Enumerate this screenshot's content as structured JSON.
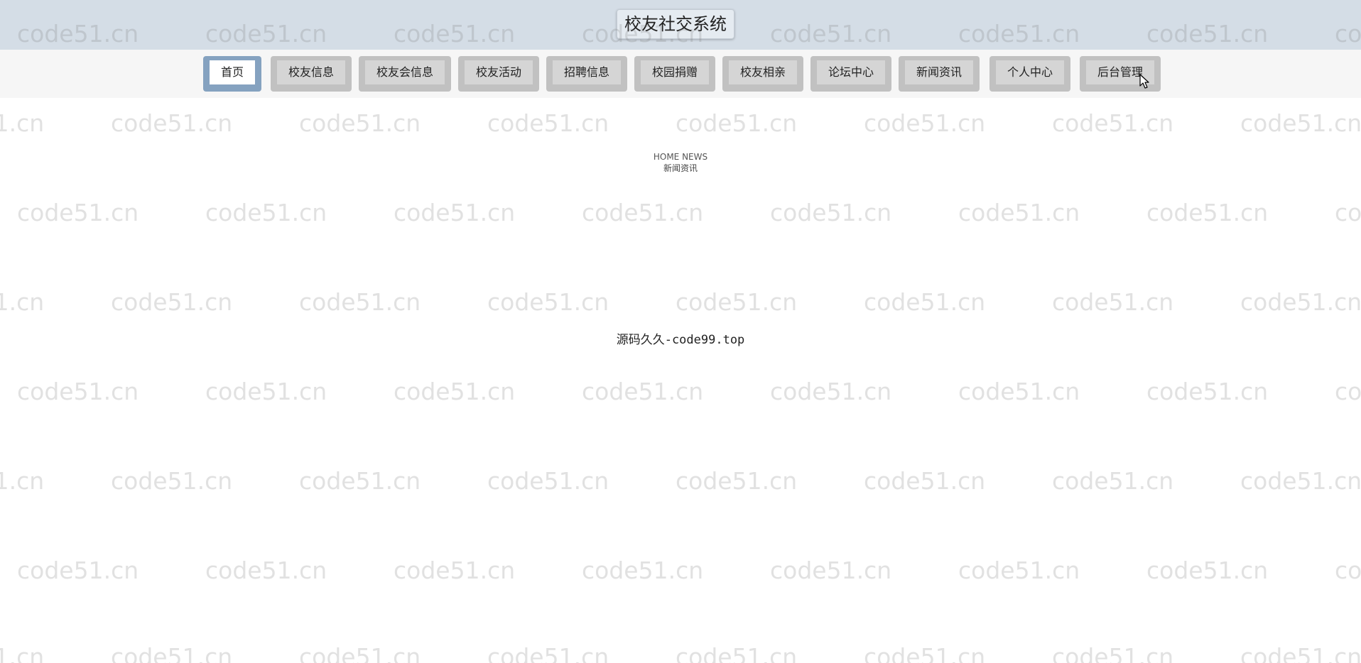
{
  "header": {
    "title": "校友社交系统"
  },
  "nav": {
    "items": [
      {
        "label": "首页",
        "active": true
      },
      {
        "label": "校友信息",
        "active": false
      },
      {
        "label": "校友会信息",
        "active": false
      },
      {
        "label": "校友活动",
        "active": false
      },
      {
        "label": "招聘信息",
        "active": false
      },
      {
        "label": "校园捐赠",
        "active": false
      },
      {
        "label": "校友相亲",
        "active": false
      },
      {
        "label": "论坛中心",
        "active": false
      },
      {
        "label": "新闻资讯",
        "active": false
      },
      {
        "label": "个人中心",
        "active": false
      },
      {
        "label": "后台管理",
        "active": false
      }
    ]
  },
  "section": {
    "english": "HOME NEWS",
    "chinese": "新闻资讯"
  },
  "footer": {
    "text": "源码久久-code99.top"
  },
  "watermark": {
    "text": "code51.cn"
  },
  "colors": {
    "header_bg": "#d4dde6",
    "nav_bg": "#f6f6f6",
    "active_border": "#85a2c0",
    "inactive_border": "#c1c1c1"
  }
}
